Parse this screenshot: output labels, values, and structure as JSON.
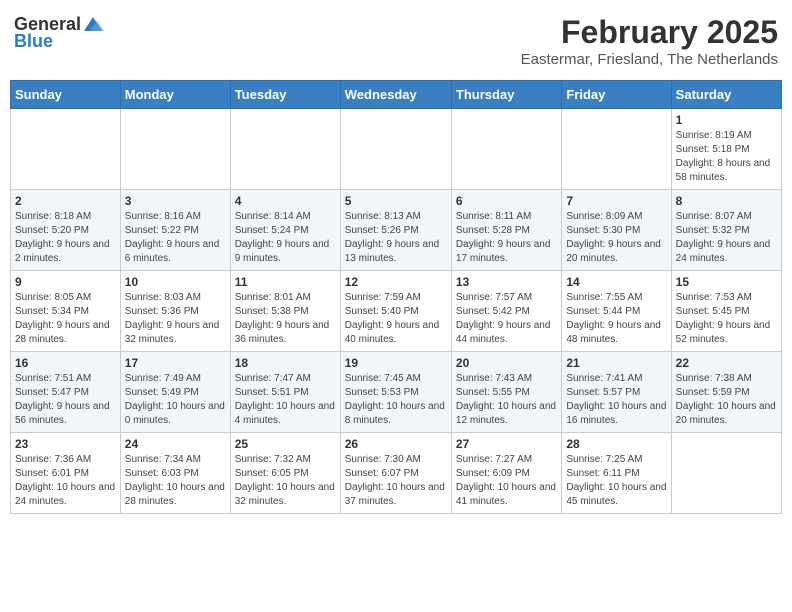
{
  "header": {
    "logo_general": "General",
    "logo_blue": "Blue",
    "month_title": "February 2025",
    "location": "Eastermar, Friesland, The Netherlands"
  },
  "weekdays": [
    "Sunday",
    "Monday",
    "Tuesday",
    "Wednesday",
    "Thursday",
    "Friday",
    "Saturday"
  ],
  "weeks": [
    [
      {
        "day": "",
        "info": ""
      },
      {
        "day": "",
        "info": ""
      },
      {
        "day": "",
        "info": ""
      },
      {
        "day": "",
        "info": ""
      },
      {
        "day": "",
        "info": ""
      },
      {
        "day": "",
        "info": ""
      },
      {
        "day": "1",
        "info": "Sunrise: 8:19 AM\nSunset: 5:18 PM\nDaylight: 8 hours and 58 minutes."
      }
    ],
    [
      {
        "day": "2",
        "info": "Sunrise: 8:18 AM\nSunset: 5:20 PM\nDaylight: 9 hours and 2 minutes."
      },
      {
        "day": "3",
        "info": "Sunrise: 8:16 AM\nSunset: 5:22 PM\nDaylight: 9 hours and 6 minutes."
      },
      {
        "day": "4",
        "info": "Sunrise: 8:14 AM\nSunset: 5:24 PM\nDaylight: 9 hours and 9 minutes."
      },
      {
        "day": "5",
        "info": "Sunrise: 8:13 AM\nSunset: 5:26 PM\nDaylight: 9 hours and 13 minutes."
      },
      {
        "day": "6",
        "info": "Sunrise: 8:11 AM\nSunset: 5:28 PM\nDaylight: 9 hours and 17 minutes."
      },
      {
        "day": "7",
        "info": "Sunrise: 8:09 AM\nSunset: 5:30 PM\nDaylight: 9 hours and 20 minutes."
      },
      {
        "day": "8",
        "info": "Sunrise: 8:07 AM\nSunset: 5:32 PM\nDaylight: 9 hours and 24 minutes."
      }
    ],
    [
      {
        "day": "9",
        "info": "Sunrise: 8:05 AM\nSunset: 5:34 PM\nDaylight: 9 hours and 28 minutes."
      },
      {
        "day": "10",
        "info": "Sunrise: 8:03 AM\nSunset: 5:36 PM\nDaylight: 9 hours and 32 minutes."
      },
      {
        "day": "11",
        "info": "Sunrise: 8:01 AM\nSunset: 5:38 PM\nDaylight: 9 hours and 36 minutes."
      },
      {
        "day": "12",
        "info": "Sunrise: 7:59 AM\nSunset: 5:40 PM\nDaylight: 9 hours and 40 minutes."
      },
      {
        "day": "13",
        "info": "Sunrise: 7:57 AM\nSunset: 5:42 PM\nDaylight: 9 hours and 44 minutes."
      },
      {
        "day": "14",
        "info": "Sunrise: 7:55 AM\nSunset: 5:44 PM\nDaylight: 9 hours and 48 minutes."
      },
      {
        "day": "15",
        "info": "Sunrise: 7:53 AM\nSunset: 5:45 PM\nDaylight: 9 hours and 52 minutes."
      }
    ],
    [
      {
        "day": "16",
        "info": "Sunrise: 7:51 AM\nSunset: 5:47 PM\nDaylight: 9 hours and 56 minutes."
      },
      {
        "day": "17",
        "info": "Sunrise: 7:49 AM\nSunset: 5:49 PM\nDaylight: 10 hours and 0 minutes."
      },
      {
        "day": "18",
        "info": "Sunrise: 7:47 AM\nSunset: 5:51 PM\nDaylight: 10 hours and 4 minutes."
      },
      {
        "day": "19",
        "info": "Sunrise: 7:45 AM\nSunset: 5:53 PM\nDaylight: 10 hours and 8 minutes."
      },
      {
        "day": "20",
        "info": "Sunrise: 7:43 AM\nSunset: 5:55 PM\nDaylight: 10 hours and 12 minutes."
      },
      {
        "day": "21",
        "info": "Sunrise: 7:41 AM\nSunset: 5:57 PM\nDaylight: 10 hours and 16 minutes."
      },
      {
        "day": "22",
        "info": "Sunrise: 7:38 AM\nSunset: 5:59 PM\nDaylight: 10 hours and 20 minutes."
      }
    ],
    [
      {
        "day": "23",
        "info": "Sunrise: 7:36 AM\nSunset: 6:01 PM\nDaylight: 10 hours and 24 minutes."
      },
      {
        "day": "24",
        "info": "Sunrise: 7:34 AM\nSunset: 6:03 PM\nDaylight: 10 hours and 28 minutes."
      },
      {
        "day": "25",
        "info": "Sunrise: 7:32 AM\nSunset: 6:05 PM\nDaylight: 10 hours and 32 minutes."
      },
      {
        "day": "26",
        "info": "Sunrise: 7:30 AM\nSunset: 6:07 PM\nDaylight: 10 hours and 37 minutes."
      },
      {
        "day": "27",
        "info": "Sunrise: 7:27 AM\nSunset: 6:09 PM\nDaylight: 10 hours and 41 minutes."
      },
      {
        "day": "28",
        "info": "Sunrise: 7:25 AM\nSunset: 6:11 PM\nDaylight: 10 hours and 45 minutes."
      },
      {
        "day": "",
        "info": ""
      }
    ]
  ]
}
